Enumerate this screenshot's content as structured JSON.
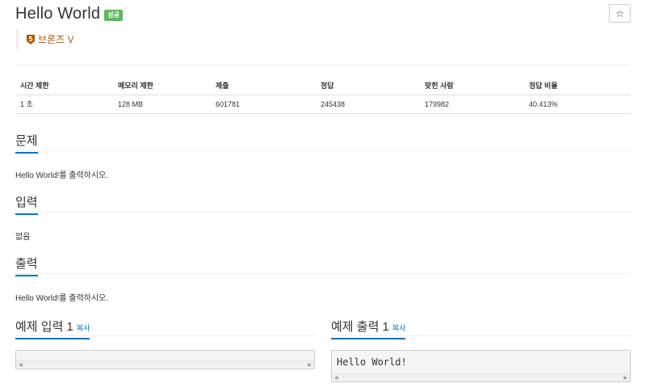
{
  "problem": {
    "title": "Hello World",
    "status_badge": "성공",
    "star_icon": "☆",
    "tier": {
      "number": "5",
      "label": "브론즈 V",
      "color": "#ad5600"
    }
  },
  "info_table": {
    "headers": [
      "시간 제한",
      "메모리 제한",
      "제출",
      "정답",
      "맞힌 사람",
      "정답 비율"
    ],
    "values": [
      "1 초",
      "128 MB",
      "601781",
      "245438",
      "179982",
      "40.413%"
    ]
  },
  "sections": {
    "description": {
      "heading": "문제",
      "text": "Hello World!를 출력하시오."
    },
    "input": {
      "heading": "입력",
      "text": "없음"
    },
    "output": {
      "heading": "출력",
      "text": "Hello World!를 출력하시오."
    }
  },
  "samples": {
    "input": {
      "heading": "예제 입력 1",
      "copy_label": "복사",
      "content": ""
    },
    "output": {
      "heading": "예제 출력 1",
      "copy_label": "복사",
      "content": "Hello World!"
    }
  },
  "colors": {
    "accent": "#0076c0",
    "success": "#5cb85c",
    "tier": "#ad5600"
  }
}
